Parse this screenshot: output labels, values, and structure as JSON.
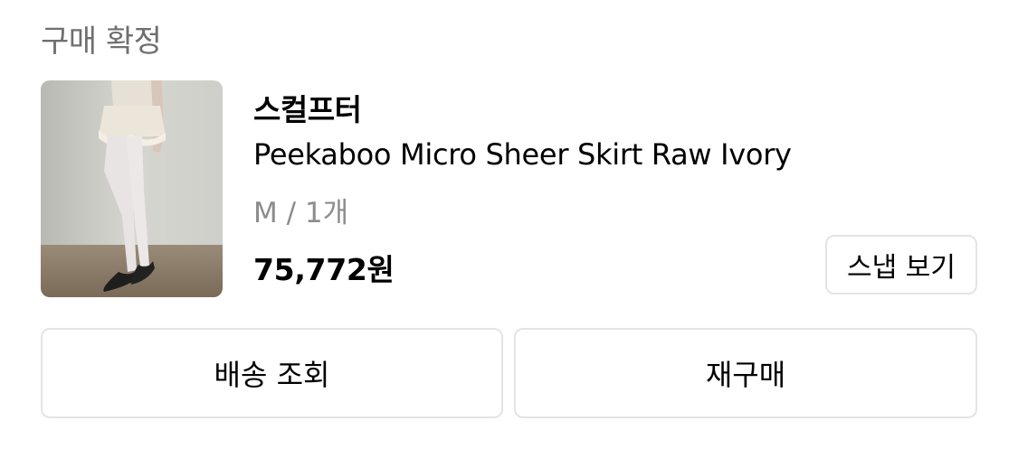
{
  "order": {
    "status": "구매 확정"
  },
  "product": {
    "brand": "스컬프터",
    "name": "Peekaboo Micro Sheer Skirt Raw Ivory",
    "option": "M / 1개",
    "price": "75,772원",
    "thumbnail_icon": "product-photo"
  },
  "buttons": {
    "snap": "스냅 보기",
    "tracking": "배송 조회",
    "rebuy": "재구매"
  },
  "colors": {
    "status_text": "#6f6f6f",
    "option_text": "#8c8c8c",
    "button_border": "#e4e4e4"
  }
}
